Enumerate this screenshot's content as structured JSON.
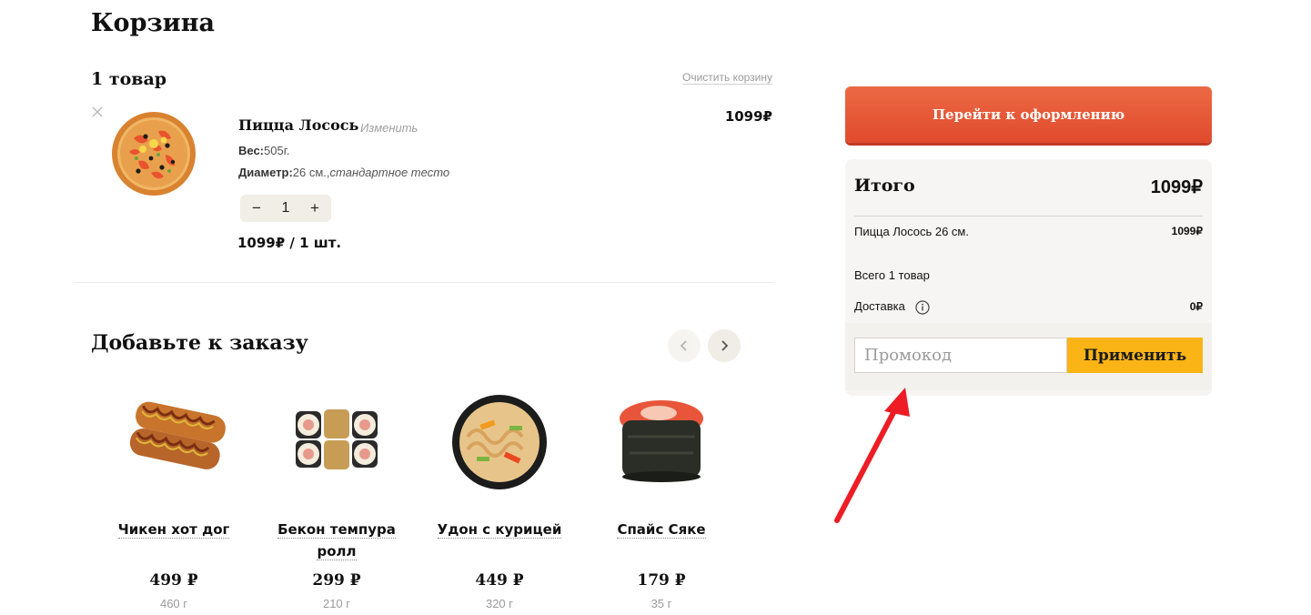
{
  "cart": {
    "title": "Корзина",
    "items_count": "1 товар",
    "clear_label": "Очистить корзину",
    "item": {
      "name": "Пицца Лосось",
      "edit_label": "Изменить",
      "price": "1099₽",
      "weight_label": "Вес:",
      "weight_value": "505г.",
      "diameter_label": "Диаметр:",
      "diameter_value": "26 см.,",
      "crust": "стандартное тесто",
      "qty_minus": "−",
      "qty": "1",
      "qty_plus": "+",
      "line_total": "1099₽ / 1 шт."
    }
  },
  "upsell": {
    "title": "Добавьте к заказу",
    "products": [
      {
        "name": "Чикен хот дог",
        "price": "499 ₽",
        "weight": "460 г"
      },
      {
        "name": "Бекон темпура ролл",
        "price": "299 ₽",
        "weight": "210 г"
      },
      {
        "name": "Удон с курицей",
        "price": "449 ₽",
        "weight": "320 г"
      },
      {
        "name": "Спайс Сяке",
        "price": "179 ₽",
        "weight": "35 г"
      }
    ]
  },
  "checkout": {
    "button_label": "Перейти к оформлению"
  },
  "summary": {
    "title": "Итого",
    "total": "1099₽",
    "line_name": "Пицца Лосось 26 см.",
    "line_price": "1099₽",
    "items_total": "Всего 1 товар",
    "delivery_label": "Доставка",
    "delivery_price": "0₽"
  },
  "promo": {
    "placeholder": "Промокод",
    "apply_label": "Применить"
  },
  "colors": {
    "accent": "#e04a2c",
    "apply": "#fbb416",
    "annotation_arrow": "#ee1c25"
  }
}
